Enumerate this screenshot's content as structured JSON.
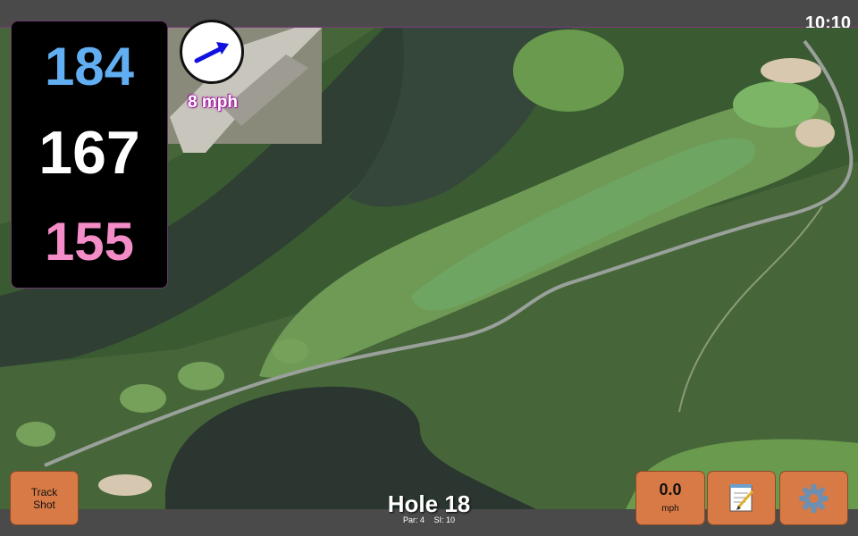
{
  "status": {
    "time": "10:10"
  },
  "yardages": {
    "back": "184",
    "center": "167",
    "front": "155"
  },
  "wind": {
    "speed_label": "8 mph",
    "arrow_color": "#1010e0"
  },
  "hole": {
    "title": "Hole 18",
    "par_label": "Par: 4",
    "si_label": "SI: 10"
  },
  "buttons": {
    "track_shot_line1": "Track",
    "track_shot_line2": "Shot",
    "speed_value": "0.0",
    "speed_unit": "mph",
    "notes_icon": "notepad-icon",
    "settings_icon": "gear-icon"
  },
  "colors": {
    "back_yardage": "#62aef2",
    "center_yardage": "#ffffff",
    "front_yardage": "#f38cc7",
    "button": "#d87a45"
  }
}
